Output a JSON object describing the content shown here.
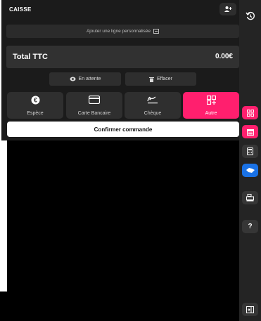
{
  "header": {
    "title": "CAISSE",
    "add_user_icon": "user-plus-icon"
  },
  "custom_line": {
    "label": "Ajouter une ligne personnalisée",
    "icon": "edit-box-icon"
  },
  "total": {
    "label": "Total TTC",
    "value": "0.00€"
  },
  "secondary_actions": {
    "hold": "En attente",
    "clear": "Effacer"
  },
  "payment_methods": [
    {
      "label": "Espèce",
      "icon": "euro-coin-icon"
    },
    {
      "label": "Carte Bancaire",
      "icon": "credit-card-icon"
    },
    {
      "label": "Chèque",
      "icon": "signature-icon"
    },
    {
      "label": "Autre",
      "icon": "qr-grid-icon"
    }
  ],
  "confirm": {
    "label": "Confirmer commande"
  },
  "sidebar": {
    "help_label": "?",
    "items": [
      "history-icon",
      "grid-icon",
      "calendar-icon",
      "calculator-icon",
      "handshake-icon",
      "cash-register-icon",
      "help-icon",
      "collapse-panel-icon"
    ]
  },
  "colors": {
    "accent": "#ff1f6e",
    "blue": "#1a72e6",
    "panel": "#1b1b1b"
  }
}
